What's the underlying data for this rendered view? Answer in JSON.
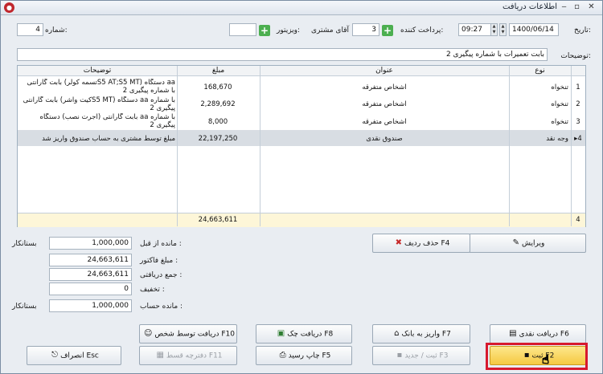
{
  "window": {
    "title": "اطلاعات دریافت",
    "app_icon": "logo-icon",
    "min": "‒",
    "max": "▫",
    "close": "✕"
  },
  "header": {
    "date_label": "تاریخ:",
    "date_value": "1400/06/14",
    "time_value": "09:27",
    "payer_label": "پرداخت کننده:",
    "payer_code": "3",
    "payer_name": "آقای مشتری",
    "visitor_label": "ویزیتور:",
    "visitor_value": "",
    "number_label": "شماره:",
    "number_value": "4"
  },
  "description": {
    "label": "توضیحات:",
    "value": "بابت تعمیرات با شماره پیگیری 2"
  },
  "left_grid": {
    "headers": {
      "desc": "توضیحات",
      "amount": "مبلغ"
    },
    "rows": [
      {
        "desc": "بابت گارانتی (تسمه کولرS5 AT;S5 MT) دستگاه aa با شماره پیگیری 2",
        "amount": "168,670"
      },
      {
        "desc": "بابت گارانتی (کیت واشرS5 MT) دستگاه aa با شماره پیگیری 2",
        "amount": "2,289,692"
      },
      {
        "desc": "بابت گارانتی (اجرت نصب) دستگاه aa با شماره پیگیری 2",
        "amount": "8,000"
      },
      {
        "desc": "مبلغ توسط مشتری به حساب صندوق واریز شد",
        "amount": "22,197,250"
      }
    ],
    "total": "24,663,611"
  },
  "right_grid": {
    "headers": {
      "title": "عنوان",
      "type": "نوع"
    },
    "rows": [
      {
        "num": "1",
        "title": "اشخاص متفرقه",
        "type": "تنخواه"
      },
      {
        "num": "2",
        "title": "اشخاص متفرقه",
        "type": "تنخواه"
      },
      {
        "num": "3",
        "title": "اشخاص متفرقه",
        "type": "تنخواه"
      },
      {
        "num": "4",
        "title": "صندوق نقدی",
        "type": "وجه نقد"
      }
    ],
    "footer_num": "4"
  },
  "summary": {
    "prev_balance_label": "مانده از قبل :",
    "prev_balance": "1,000,000",
    "prev_balance_state": "بستانکار",
    "invoice_label": "مبلغ فاکتور :",
    "invoice": "24,663,611",
    "received_label": "جمع دریافتی :",
    "received": "24,663,611",
    "discount_label": "تخفیف :",
    "discount": "0",
    "account_label": "مانده حساب :",
    "account": "1,000,000",
    "account_state": "بستانکار"
  },
  "buttons": {
    "edit": "ویرایش",
    "delete_row": "حذف ردیف F4",
    "cash": "دریافت نقدی F6",
    "bank": "واریز به بانک F7",
    "cheque": "دریافت چک F8",
    "person": "دریافت توسط شخص F10",
    "save": "ثبت F2",
    "save_new": "ثبت / جدید F3",
    "print": "چاپ رسید F5",
    "installment": "دفترچه قسط F11",
    "cancel": "انصراف Esc"
  }
}
